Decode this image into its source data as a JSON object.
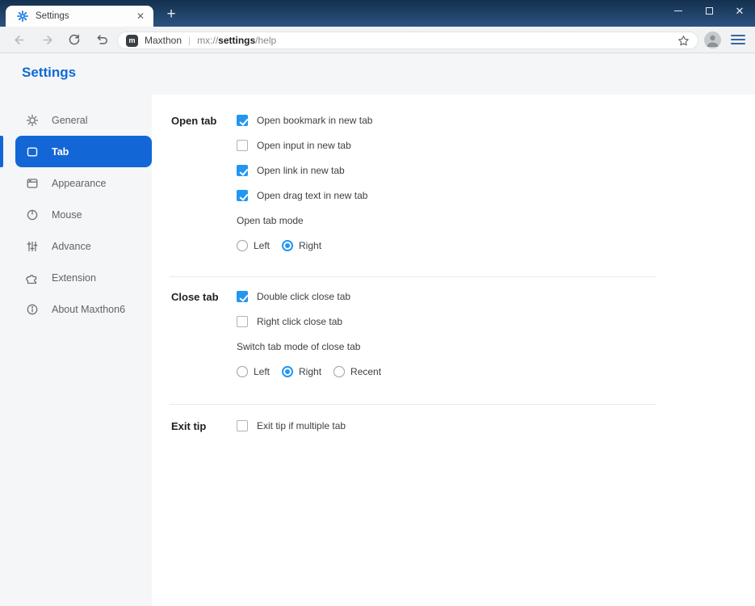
{
  "titlebar": {
    "tab_title": "Settings",
    "icons": [
      "gear-favicon-icon",
      "tab-close-icon",
      "new-tab-icon",
      "minimize-icon",
      "maximize-icon",
      "window-close-icon"
    ]
  },
  "navbar": {
    "icons": [
      "back-icon",
      "forward-icon",
      "reload-icon",
      "undo-icon",
      "star-icon",
      "avatar-icon",
      "hamburger-menu-icon"
    ],
    "logo_letter": "m",
    "url_brand": "Maxthon",
    "url_separator": "|",
    "url_scheme": "mx://",
    "url_host": "settings",
    "url_path": "/help"
  },
  "page": {
    "title": "Settings"
  },
  "sidebar": {
    "items": [
      {
        "label": "General",
        "icon": "gear-icon",
        "selected": false
      },
      {
        "label": "Tab",
        "icon": "tab-icon",
        "selected": true
      },
      {
        "label": "Appearance",
        "icon": "window-icon",
        "selected": false
      },
      {
        "label": "Mouse",
        "icon": "mouse-icon",
        "selected": false
      },
      {
        "label": "Advance",
        "icon": "sliders-icon",
        "selected": false
      },
      {
        "label": "Extension",
        "icon": "puzzle-icon",
        "selected": false
      },
      {
        "label": "About Maxthon6",
        "icon": "info-icon",
        "selected": false
      }
    ]
  },
  "sections": [
    {
      "label": "Open tab",
      "rows": [
        {
          "type": "checkbox",
          "checked": true,
          "label": "Open bookmark in new tab"
        },
        {
          "type": "checkbox",
          "checked": false,
          "label": "Open input in new tab"
        },
        {
          "type": "checkbox",
          "checked": true,
          "label": "Open link in new tab"
        },
        {
          "type": "checkbox",
          "checked": true,
          "label": "Open drag text in new tab"
        },
        {
          "type": "text",
          "label": "Open tab mode"
        },
        {
          "type": "radio-group",
          "options": [
            {
              "label": "Left",
              "selected": false
            },
            {
              "label": "Right",
              "selected": true
            }
          ]
        }
      ]
    },
    {
      "label": "Close tab",
      "rows": [
        {
          "type": "checkbox",
          "checked": true,
          "label": "Double click close tab"
        },
        {
          "type": "checkbox",
          "checked": false,
          "label": "Right click close tab"
        },
        {
          "type": "text",
          "label": "Switch tab mode of close tab"
        },
        {
          "type": "radio-group",
          "options": [
            {
              "label": "Left",
              "selected": false
            },
            {
              "label": "Right",
              "selected": true
            },
            {
              "label": "Recent",
              "selected": false
            }
          ]
        }
      ]
    },
    {
      "label": "Exit tip",
      "rows": [
        {
          "type": "checkbox",
          "checked": false,
          "label": "Exit tip if multiple tab"
        }
      ]
    }
  ],
  "colors": {
    "accent": "#1366d6",
    "control_blue": "#2196f3",
    "title_blue": "#0f6ad4",
    "titlebar_top": "#14304f",
    "titlebar_bottom": "#2b5381",
    "sidebar_bg": "#f5f6f8"
  }
}
